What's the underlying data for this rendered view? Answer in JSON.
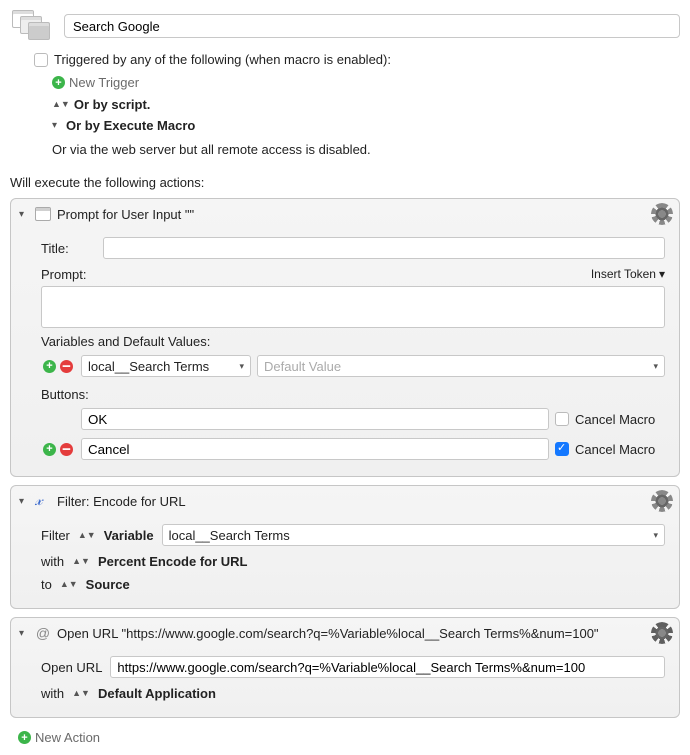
{
  "header": {
    "title": "Search Google"
  },
  "triggers": {
    "label": "Triggered by any of the following (when macro is enabled):",
    "new_trigger": "New Trigger",
    "or_script": "Or by script.",
    "or_execute": "Or by Execute Macro",
    "or_web": "Or via the web server but all remote access is disabled."
  },
  "exec_label": "Will execute the following actions:",
  "action1": {
    "title": "Prompt for User Input \"\"",
    "title_lbl": "Title:",
    "prompt_lbl": "Prompt:",
    "insert_token": "Insert Token",
    "vars_lbl": "Variables and Default Values:",
    "var_name": "local__Search Terms",
    "default_ph": "Default Value",
    "buttons_lbl": "Buttons:",
    "btn1": "OK",
    "btn2": "Cancel",
    "cancel_macro": "Cancel Macro"
  },
  "action2": {
    "title": "Filter: Encode for URL",
    "filter_lbl": "Filter",
    "variable_lbl": "Variable",
    "var_name": "local__Search Terms",
    "with_lbl": "with",
    "encode": "Percent Encode for URL",
    "to_lbl": "to",
    "source": "Source"
  },
  "action3": {
    "title": "Open URL \"https://www.google.com/search?q=%Variable%local__Search Terms%&num=100\"",
    "open_lbl": "Open URL",
    "url": "https://www.google.com/search?q=%Variable%local__Search Terms%&num=100",
    "with_lbl": "with",
    "default_app": "Default Application"
  },
  "new_action": "New Action"
}
